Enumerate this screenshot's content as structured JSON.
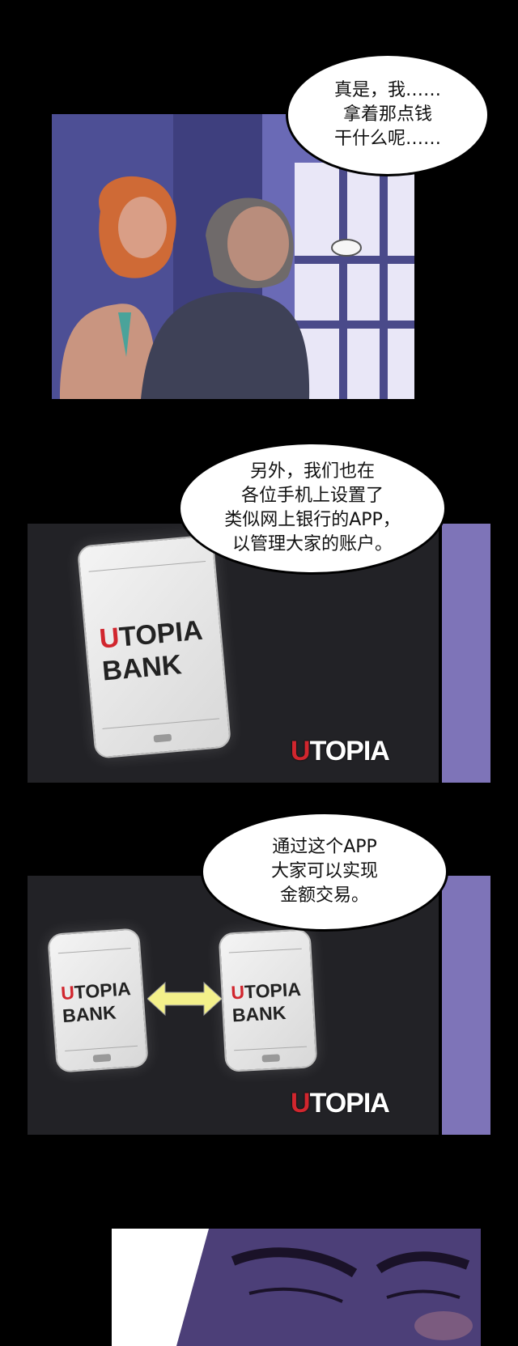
{
  "panels": {
    "panel1": {
      "bubble": "真是，我……\n拿着那点钱\n干什么呢……"
    },
    "panel2": {
      "bubble": "另外，我们也在\n各位手机上设置了\n类似网上银行的APP，\n以管理大家的账户。",
      "phone": {
        "first_letter": "U",
        "line1_rest": "TOPIA",
        "line2": "BANK"
      },
      "logo": {
        "first_letter": "U",
        "rest": "TOPIA"
      }
    },
    "panel3": {
      "bubble": "通过这个APP\n大家可以实现\n金额交易。",
      "phones": [
        {
          "first_letter": "U",
          "line1_rest": "TOPIA",
          "line2": "BANK"
        },
        {
          "first_letter": "U",
          "line1_rest": "TOPIA",
          "line2": "BANK"
        }
      ],
      "logo": {
        "first_letter": "U",
        "rest": "TOPIA"
      },
      "arrow_color": "#f3f08a"
    }
  },
  "colors": {
    "night_bg": "#4a4a8a",
    "dark_panel": "#222226",
    "purple_wall": "#7e74b8",
    "accent_red": "#d1262e"
  }
}
